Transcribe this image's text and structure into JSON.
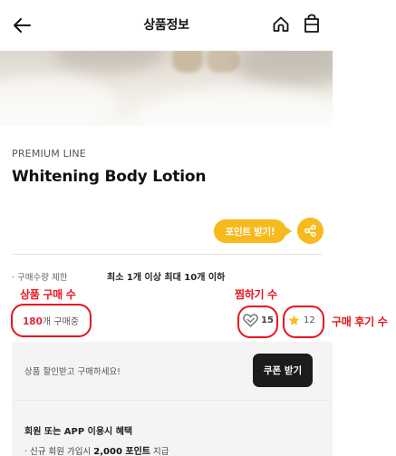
{
  "header": {
    "title": "상품정보",
    "back_icon": "arrow-left-icon",
    "home_icon": "home-icon",
    "bag_icon": "shopping-bag-icon"
  },
  "product": {
    "brand_line": "PREMIUM LINE",
    "name": "Whitening Body Lotion",
    "point_badge": "포인트 받기!",
    "share_icon": "share-icon"
  },
  "purchase_limit": {
    "label": "· 구매수량 제한",
    "value": "최소 1개 이상 최대 10개 이하"
  },
  "stats": {
    "purchase_count": "180",
    "purchase_suffix": "개 구매중",
    "wish_count": "15",
    "review_count": "12",
    "wish_icon": "heart-icon",
    "review_icon": "star-icon"
  },
  "coupon": {
    "text": "상품 할인받고 구매하세요!",
    "button": "쿠폰 받기"
  },
  "member_benefit": {
    "title": "회원 또는 APP 이용시 혜택",
    "item_prefix": "· 신규 회원 가입시 ",
    "item_points": "2,000 포인트",
    "item_suffix": " 지급"
  },
  "annotations": {
    "purchase_label": "상품 구매 수",
    "wish_label": "찜하기 수",
    "review_label": "구매 후기 수"
  },
  "colors": {
    "accent": "#f7b91e",
    "purchase_number": "#e0263a",
    "annotation": "#e8141e",
    "coupon_button": "#1c1c1c"
  }
}
